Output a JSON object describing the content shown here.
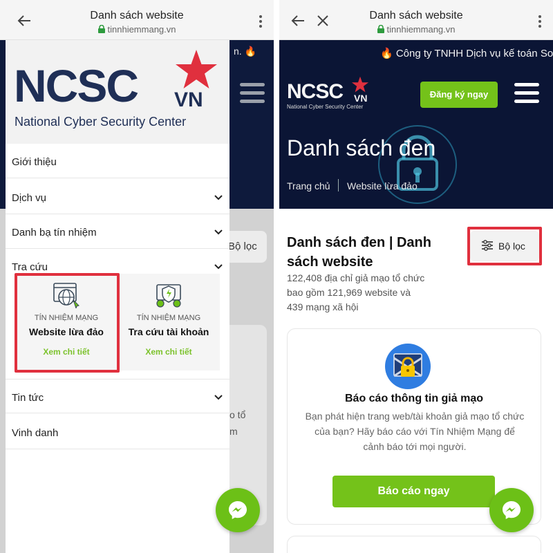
{
  "browser": {
    "title": "Danh sách website",
    "url": "tinnhiemmang.vn"
  },
  "brand": {
    "logo_text": "NCSC",
    "logo_suffix": "VN",
    "logo_subtitle": "National Cyber Security Center",
    "accent_color": "#74c21a",
    "navy_color": "#1f2f56",
    "star_color": "#e0303e"
  },
  "left": {
    "background_ticker": "n. 🔥",
    "background_filter_label": "Bộ lọc",
    "background_fragments": [
      "o tổ",
      "m"
    ],
    "menu": [
      {
        "label": "Giới thiệu",
        "has_chevron": false
      },
      {
        "label": "Dịch vụ",
        "has_chevron": true
      },
      {
        "label": "Danh bạ tín nhiệm",
        "has_chevron": true
      },
      {
        "label": "Tra cứu",
        "has_chevron": true
      },
      {
        "label": "Tin tức",
        "has_chevron": true
      },
      {
        "label": "Vinh danh",
        "has_chevron": false
      }
    ],
    "sub_cards": [
      {
        "eyebrow": "TÍN NHIỆM MẠNG",
        "title": "Website lừa đảo",
        "link": "Xem chi tiết",
        "icon": "globe-browser-icon",
        "highlighted": true
      },
      {
        "eyebrow": "TÍN NHIỆM MẠNG",
        "title": "Tra cứu tài khoản",
        "link": "Xem chi tiết",
        "icon": "shield-gear-icon",
        "highlighted": false
      }
    ]
  },
  "right": {
    "ticker": "🔥 Công ty TNHH Dịch vụ kế toán So",
    "register_button": "Đăng ký ngay",
    "hero_title": "Danh sách đen",
    "breadcrumb": {
      "home": "Trang chủ",
      "current": "Website lừa đảo"
    },
    "heading": "Danh sách đen | Danh sách website",
    "description": "122,408 địa chỉ giả mạo tổ chức bao gồm 121,969 website và 439 mạng xã hội",
    "filter_label": "Bộ lọc",
    "report_card": {
      "title": "Báo cáo thông tin giả mạo",
      "description": "Bạn phát hiện trang web/tài khoản giả mạo tổ chức của bạn? Hãy báo cáo với Tín Nhiệm Mạng để cảnh báo tới mọi người.",
      "button": "Báo cáo ngay"
    }
  }
}
